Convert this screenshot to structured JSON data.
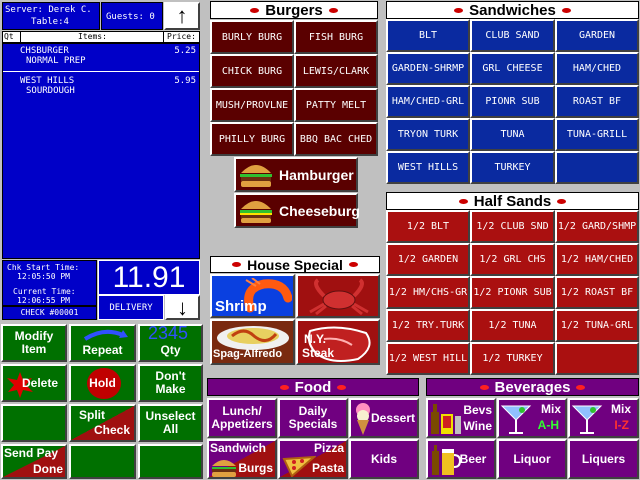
{
  "order": {
    "server_line": "Server: Derek C.",
    "table_line": "Table:4",
    "guests_line": "Guests: 0",
    "col_qty": "Qt",
    "col_items": "Items:",
    "col_price": "Price:",
    "items": [
      {
        "name": "CHSBURGER",
        "mod": "NORMAL PREP",
        "price": "5.25"
      },
      {
        "name": "WEST HILLS",
        "mod": "SOURDOUGH",
        "price": "5.95"
      }
    ],
    "chk_start_label": "Chk Start Time:",
    "chk_start_value": "12:05:50 PM",
    "current_label": "Current Time:",
    "current_value": "12:06:55 PM",
    "check_no": "CHECK #00001",
    "total": "11.91",
    "order_type": "DELIVERY",
    "scroll_up": "↑",
    "scroll_down": "↓"
  },
  "controls": {
    "modify": "Modify Item",
    "repeat": "Repeat",
    "qty_num": "2345",
    "qty": "Qty",
    "delete": "Delete",
    "hold": "Hold",
    "dont_make": "Don't Make",
    "split": "Split",
    "check": "Check",
    "unselect": "Unselect All",
    "send_pay": "Send Pay",
    "done": "Done"
  },
  "burgers": {
    "title": "Burgers",
    "items": [
      "BURLY BURG",
      "FISH BURG",
      "CHICK BURG",
      "LEWIS/CLARK",
      "MUSH/PROVLNE",
      "PATTY MELT",
      "PHILLY BURG",
      "BBQ BAC CHED"
    ],
    "hamburger": "Hamburger",
    "cheeseburg": "Cheeseburg"
  },
  "house_special": {
    "title": "House Special",
    "shrimp": "Shrimp",
    "spag": "Spag-Alfredo",
    "steak_line1": "N.Y.",
    "steak_line2": "Steak"
  },
  "sandwiches": {
    "title": "Sandwiches",
    "items": [
      "BLT",
      "CLUB SAND",
      "GARDEN",
      "GARDEN-SHRMP",
      "GRL CHEESE",
      "HAM/CHED",
      "HAM/CHED-GRL",
      "PIONR SUB",
      "ROAST BF",
      "TRYON TURK",
      "TUNA",
      "TUNA-GRILL",
      "WEST HILLS",
      "TURKEY",
      ""
    ]
  },
  "half_sands": {
    "title": "Half Sands",
    "items": [
      "1/2 BLT",
      "1/2 CLUB SND",
      "1/2 GARD/SHMP",
      "1/2 GARDEN",
      "1/2 GRL CHS",
      "1/2 HAM/CHED",
      "1/2 HM/CHS-GR",
      "1/2 PIONR SUB",
      "1/2 ROAST BF",
      "1/2 TRY.TURK",
      "1/2 TUNA",
      "1/2 TUNA-GRL",
      "1/2 WEST HILL",
      "1/2 TURKEY",
      ""
    ]
  },
  "food": {
    "title": "Food",
    "lunch": "Lunch/ Appetizers",
    "daily": "Daily Specials",
    "dessert": "Dessert",
    "sandwich": "Sandwich",
    "burgs": "Burgs",
    "pizza": "Pizza",
    "pasta": "Pasta",
    "kids": "Kids"
  },
  "beverages": {
    "title": "Beverages",
    "bevs": "Bevs",
    "wine": "Wine",
    "mix": "Mix",
    "mix_ah": "A-H",
    "mix_iz": "I-Z",
    "beer": "Beer",
    "liquor": "Liquor",
    "liquers": "Liquers"
  },
  "colors": {
    "burger_btn": "#5a0000",
    "sandwich_btn": "#0a2aa0",
    "half_btn": "#aa1010",
    "order_panel": "#0000c8",
    "food_btn": "#700080",
    "control_btn": "#007000"
  }
}
